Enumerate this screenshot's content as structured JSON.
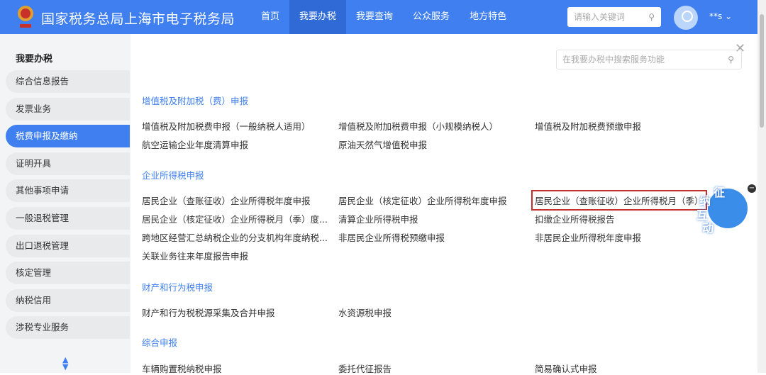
{
  "header": {
    "title": "国家税务总局上海市电子税务局",
    "nav": [
      "首页",
      "我要办税",
      "我要查询",
      "公众服务",
      "地方特色"
    ],
    "active_nav": 1,
    "search_placeholder": "请输入关键词",
    "user": "**s"
  },
  "sidebar": {
    "title": "我要办税",
    "items": [
      "综合信息报告",
      "发票业务",
      "税费申报及缴纳",
      "证明开具",
      "其他事项申请",
      "一般退税管理",
      "出口退税管理",
      "核定管理",
      "纳税信用",
      "涉税专业服务"
    ],
    "active": 2
  },
  "content": {
    "search_placeholder": "在我要办税中搜索服务功能",
    "sections": [
      {
        "title": "增值税及附加税（费）申报",
        "items": [
          "增值税及附加税费申报（一般纳税人适用）",
          "增值税及附加税费申报（小规模纳税人）",
          "增值税及附加税费预缴申报",
          "航空运输企业年度清算申报",
          "原油天然气增值税申报"
        ]
      },
      {
        "title": "企业所得税申报",
        "items": [
          "居民企业（查账征收）企业所得税年度申报",
          "居民企业（核定征收）企业所得税年度申报",
          "居民企业（查账征收）企业所得税月（季）",
          "居民企业（核定征收）企业所得税月（季）度...",
          "清算企业所得税申报",
          "扣缴企业所得税报告",
          "跨地区经营汇总纳税企业的分支机构年度纳税...",
          "非居民企业所得税预缴申报",
          "非居民企业所得税年度申报",
          "关联业务往来年度报告申报"
        ]
      },
      {
        "title": "财产和行为税申报",
        "items": [
          "财产和行为税税源采集及合并申报",
          "水资源税申报"
        ]
      },
      {
        "title": "综合申报",
        "items": [
          "车辆购置税纳税申报",
          "委托代征报告",
          "简易确认式申报"
        ]
      }
    ]
  },
  "mascot": {
    "text": [
      "征",
      "纳",
      "互",
      "动"
    ]
  }
}
